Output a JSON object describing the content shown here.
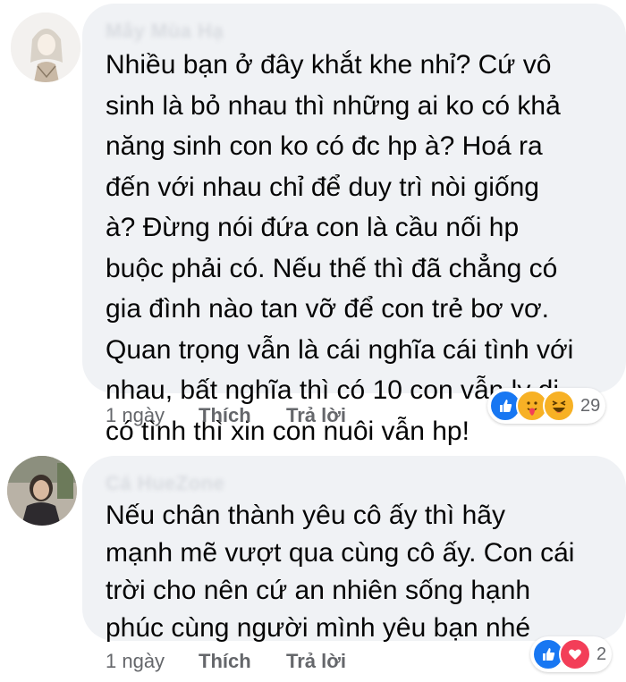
{
  "comments": [
    {
      "author": "Mây Mùa Hạ",
      "text": "Nhiều bạn ở đây khắt khe nhỉ? Cứ vô\nsinh là bỏ nhau thì những ai ko có khả\nnăng sinh con ko có đc hp à? Hoá ra\nđến với nhau chỉ để duy trì nòi giống\nà? Đừng nói đứa con là cầu nối hp\nbuộc phải có. Nếu thế thì đã chẳng có\ngia đình nào tan vỡ để con trẻ bơ vơ.\nQuan trọng vẫn là cái nghĩa cái tình với\nnhau, bất nghĩa thì có 10 con vẫn ly dị,\ncó tình thì xin con nuôi vẫn hp!",
      "time": "1 ngày",
      "like_label": "Thích",
      "reply_label": "Trả lời",
      "reactions": [
        "like-icon",
        "care-icon",
        "haha-icon"
      ],
      "reaction_count": "29"
    },
    {
      "author": "Cá HueZone",
      "text": "Nếu chân thành yêu cô ấy thì hãy\nmạnh mẽ vượt qua cùng cô ấy. Con cái\ntrời cho nên cứ an nhiên sống hạnh\nphúc cùng người mình yêu bạn nhé",
      "time": "1 ngày",
      "like_label": "Thích",
      "reply_label": "Trả lời",
      "reactions": [
        "like-icon",
        "love-icon"
      ],
      "reaction_count": "2"
    }
  ]
}
